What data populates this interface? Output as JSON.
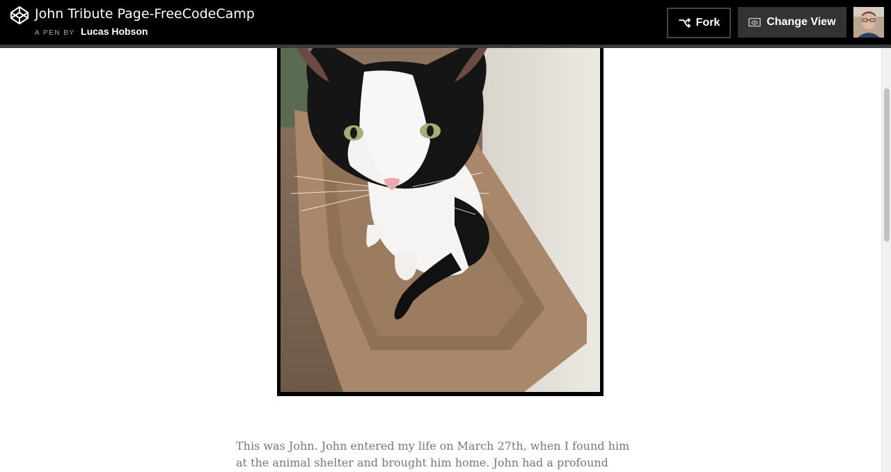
{
  "header": {
    "title": "John Tribute Page-FreeCodeCamp",
    "byline_prefix": "A PEN BY",
    "author": "Lucas Hobson",
    "logo_icon": "codepen-logo-icon"
  },
  "toolbar": {
    "fork_label": "Fork",
    "fork_icon": "fork-icon",
    "change_view_label": "Change View",
    "change_view_icon": "eye-icon",
    "avatar_icon": "user-avatar"
  },
  "main": {
    "photo_alt": "John the cat",
    "tribute_text": "This was John. John entered my life on March 27th, when I found him at the animal shelter and brought him home. John had a profound impact on me– I"
  },
  "colors": {
    "topbar_bg": "#000000",
    "button_bg": "#333333",
    "text": "#777777"
  }
}
